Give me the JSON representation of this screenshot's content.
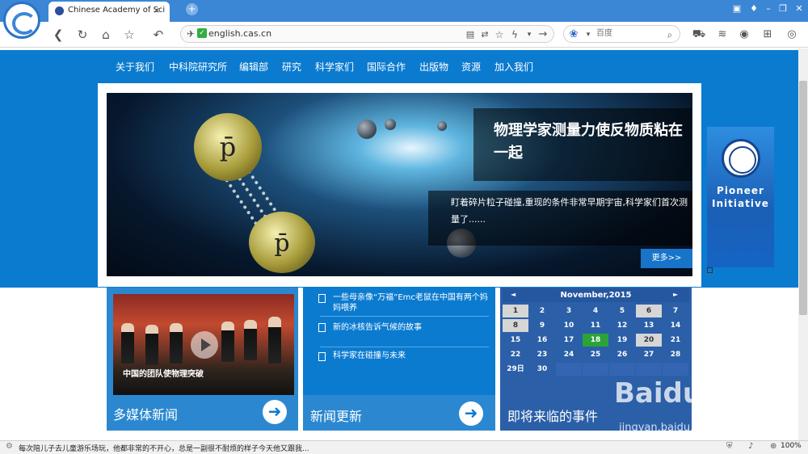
{
  "browser": {
    "tab_title": "Chinese Academy of Sci",
    "tab_close": "×",
    "new_tab": "+",
    "url": "english.cas.cn",
    "search_placeholder": "百度",
    "window_controls": [
      "□",
      "‾",
      "–",
      "▢",
      "✕"
    ],
    "zoom": "100%",
    "status_text": "每次陪儿子去儿童游乐场玩，他都非常的不开心，总是一副很不耐烦的样子今天他又跟我..."
  },
  "nav": {
    "items": [
      "关于我们",
      "中科院研究所",
      "编辑部",
      "研究",
      "科学家们",
      "国际合作",
      "出版物",
      "资源",
      "加入我们"
    ]
  },
  "hero": {
    "ball_symbol": "p̄",
    "headline": "物理学家测量力使反物质粘在一起",
    "summary": "盯着碎片粒子碰撞,重现的条件非常早期宇宙,科学家们首次测量了......",
    "more_label": "更多>>"
  },
  "pioneer": {
    "label": "Pioneer Initiative"
  },
  "panels": {
    "multimedia": {
      "title": "多媒体新闻",
      "caption": "中国的团队使物理突破"
    },
    "news": {
      "title": "新闻更新",
      "items": [
        "一些母亲像“万福”Emc老鼠在中国有两个妈妈喂养",
        "新的冰核告诉气候的故事",
        "科学家在碰撞与未来"
      ]
    },
    "events": {
      "title": "即将来临的事件",
      "month": "November,2015",
      "prev": "◄",
      "next": "►",
      "days": [
        [
          "1",
          "2",
          "3",
          "4",
          "5",
          "6",
          "7"
        ],
        [
          "8",
          "9",
          "10",
          "11",
          "12",
          "13",
          "14"
        ],
        [
          "15",
          "16",
          "17",
          "18",
          "19",
          "20",
          "21"
        ],
        [
          "22",
          "23",
          "24",
          "25",
          "26",
          "27",
          "28"
        ],
        [
          "29日",
          "30",
          "",
          "",
          "",
          "",
          ""
        ]
      ]
    }
  },
  "watermark": {
    "brand": "Baidu 经验",
    "url": "jingyan.baidu.com"
  },
  "colors": {
    "brand_blue": "#0b7bd0",
    "today_green": "#2ba339"
  }
}
